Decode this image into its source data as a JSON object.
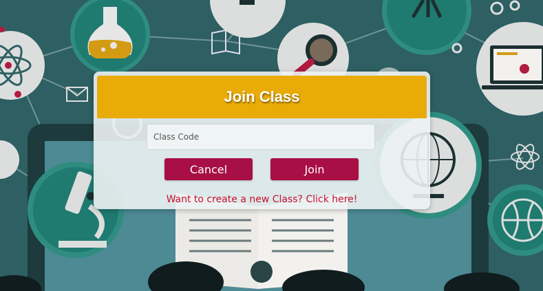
{
  "modal": {
    "title": "Join Class",
    "class_code_placeholder": "Class Code",
    "cancel_label": "Cancel",
    "join_label": "Join",
    "create_link": "Want to create a new Class? Click here!"
  },
  "colors": {
    "header": "#e9ab08",
    "button": "#a80f44",
    "link": "#c8102e",
    "background": "#2e5f62"
  },
  "background_icons": [
    "atom-icon",
    "flask-icon",
    "book-icon",
    "magnifier-icon",
    "tripod-icon",
    "gear-icon",
    "laptop-icon",
    "mail-icon",
    "at-icon",
    "microscope-icon",
    "globe-icon",
    "basketball-icon",
    "chat-icon"
  ]
}
